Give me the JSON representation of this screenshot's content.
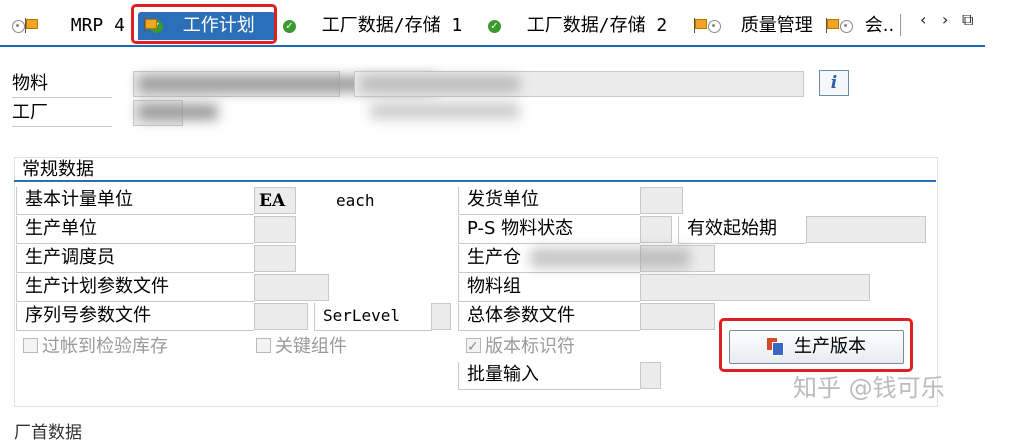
{
  "tabs": [
    {
      "label": "MRP 4",
      "icon": "ring-flag-icon"
    },
    {
      "label": "工作计划",
      "icon": "flag-check-icon",
      "active": true
    },
    {
      "label": "工厂数据/存储 1",
      "icon": "flag-check-icon"
    },
    {
      "label": "工厂数据/存储 2",
      "icon": "flag-ring-icon"
    },
    {
      "label": "质量管理",
      "icon": "flag-ring-icon"
    },
    {
      "label": "会..",
      "icon": "flag-ring-icon"
    }
  ],
  "tab_nav": {
    "prev": "‹",
    "next": "›",
    "menu": "⧉"
  },
  "header": {
    "material_label": "物料",
    "plant_label": "工厂",
    "info_button": "i"
  },
  "general_data": {
    "title": "常规数据",
    "base_unit_label": "基本计量单位",
    "base_unit_value": "EA",
    "base_unit_text": "each",
    "issue_unit_label": "发货单位",
    "prod_unit_label": "生产单位",
    "ps_status_label": "P-S 物料状态",
    "valid_from_label": "有效起始期",
    "prod_scheduler_label": "生产调度员",
    "prod_storage_label": "生产仓",
    "prod_profile_label": "生产计划参数文件",
    "material_group_label": "物料组",
    "serial_profile_label": "序列号参数文件",
    "serlevel_label": "SerLevel",
    "overall_profile_label": "总体参数文件",
    "post_to_inspection_label": "过帐到检验库存",
    "critical_part_label": "关键组件",
    "version_indicator_label": "版本标识符",
    "batch_entry_label": "批量输入",
    "production_version_button": "生产版本"
  },
  "next_section_title": "厂首数据",
  "watermark": "知乎 @钱可乐",
  "colors": {
    "tab_active": "#2b6fb8",
    "highlight": "#e02020",
    "flag": "#f0a623",
    "check": "#3a9a2e"
  }
}
